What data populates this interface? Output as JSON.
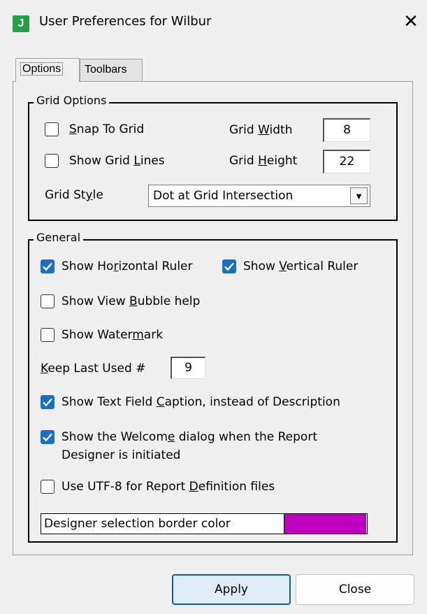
{
  "window": {
    "app_icon_letter": "J",
    "title": "User Preferences for Wilbur",
    "close_glyph": "✕"
  },
  "tabs": [
    {
      "label": "Options",
      "selected": true
    },
    {
      "label": "Toolbars",
      "selected": false
    }
  ],
  "grid_options": {
    "title": "Grid Options",
    "snap_to_grid": {
      "label": "Snap To Grid",
      "checked": false
    },
    "show_grid_lines": {
      "label": "Show Grid Lines",
      "checked": false
    },
    "grid_width": {
      "label": "Grid Width",
      "value": "8"
    },
    "grid_height": {
      "label": "Grid Height",
      "value": "22"
    },
    "grid_style": {
      "label": "Grid Style",
      "selected": "Dot at Grid Intersection"
    }
  },
  "general": {
    "title": "General",
    "show_horizontal_ruler": {
      "label": "Show Horizontal Ruler",
      "checked": true
    },
    "show_vertical_ruler": {
      "label": "Show Vertical Ruler",
      "checked": true
    },
    "show_view_bubble_help": {
      "label": "Show View Bubble help",
      "checked": false
    },
    "show_watermark": {
      "label": "Show Watermark",
      "checked": false
    },
    "keep_last_used": {
      "label": "Keep Last Used #",
      "value": "9"
    },
    "show_text_field_caption": {
      "label": "Show Text Field Caption, instead of Description",
      "checked": true
    },
    "show_welcome_dialog": {
      "label_line1": "Show the Welcome dialog when the Report",
      "label_line2": "Designer is initiated",
      "checked": true
    },
    "use_utf8": {
      "label": "Use UTF-8 for Report Definition files",
      "checked": false
    },
    "selection_border_color": {
      "label": "Designer selection border color",
      "color": "#c000c0"
    }
  },
  "buttons": {
    "apply": "Apply",
    "close": "Close"
  },
  "icons": {
    "dropdown": "▼",
    "checkmark": "checkmark-icon"
  }
}
